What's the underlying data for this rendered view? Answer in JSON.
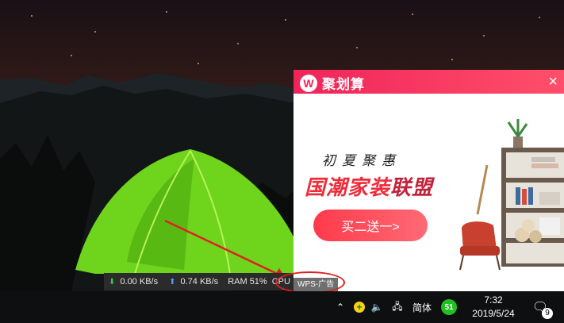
{
  "network_monitor": {
    "down_speed": "0.00 KB/s",
    "up_speed": "0.74 KB/s",
    "ram": "RAM 51%",
    "cpu": "CPU"
  },
  "ad": {
    "brand_logo": "W",
    "brand_name": "聚划算",
    "close_icon": "×",
    "slogan_line1": "初夏聚惠",
    "slogan_line2_part1": "国潮家装",
    "slogan_line2_part2": "联盟",
    "cta": "买二送一>",
    "tag": "WPS-广告"
  },
  "tray": {
    "ime": "简体",
    "security_badge": "51",
    "time": "7:32",
    "date": "2019/5/24",
    "notifications_count": "9"
  },
  "colors": {
    "ad_header": "#f0245a",
    "cta": "#ff3a4c",
    "taskbar": "#0e0f11",
    "annotation": "#e02020"
  }
}
